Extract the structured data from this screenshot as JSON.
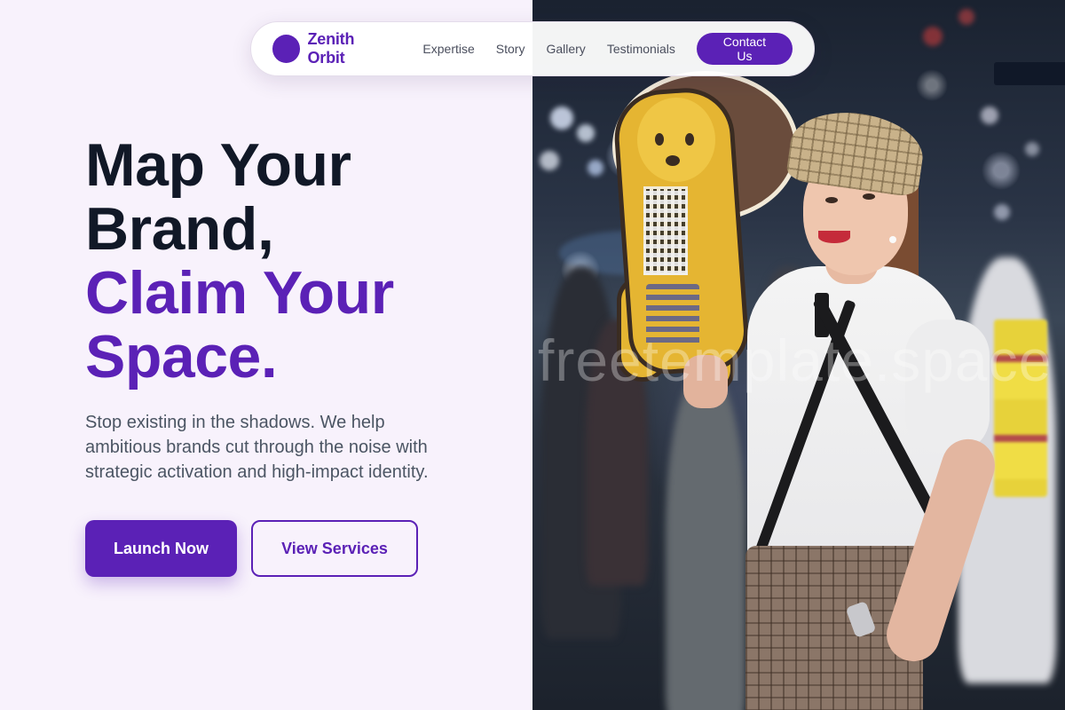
{
  "nav": {
    "brand_name": "Zenith Orbit",
    "links": [
      "Expertise",
      "Story",
      "Gallery",
      "Testimonials"
    ],
    "contact_label": "Contact Us"
  },
  "hero": {
    "title_line1": "Map Your",
    "title_line2": "Brand,",
    "title_line3": "Claim Your",
    "title_line4": "Space.",
    "subtitle": "Stop existing in the shadows. We help ambitious brands cut through the noise with strategic activation and high-impact identity.",
    "primary_cta": "Launch Now",
    "secondary_cta": "View Services"
  },
  "photo": {
    "watermark": "freetemplate.space"
  },
  "colors": {
    "accent": "#5b21b6",
    "heading": "#111827",
    "body_text": "#4b5563",
    "background": "#f8f2fc"
  }
}
